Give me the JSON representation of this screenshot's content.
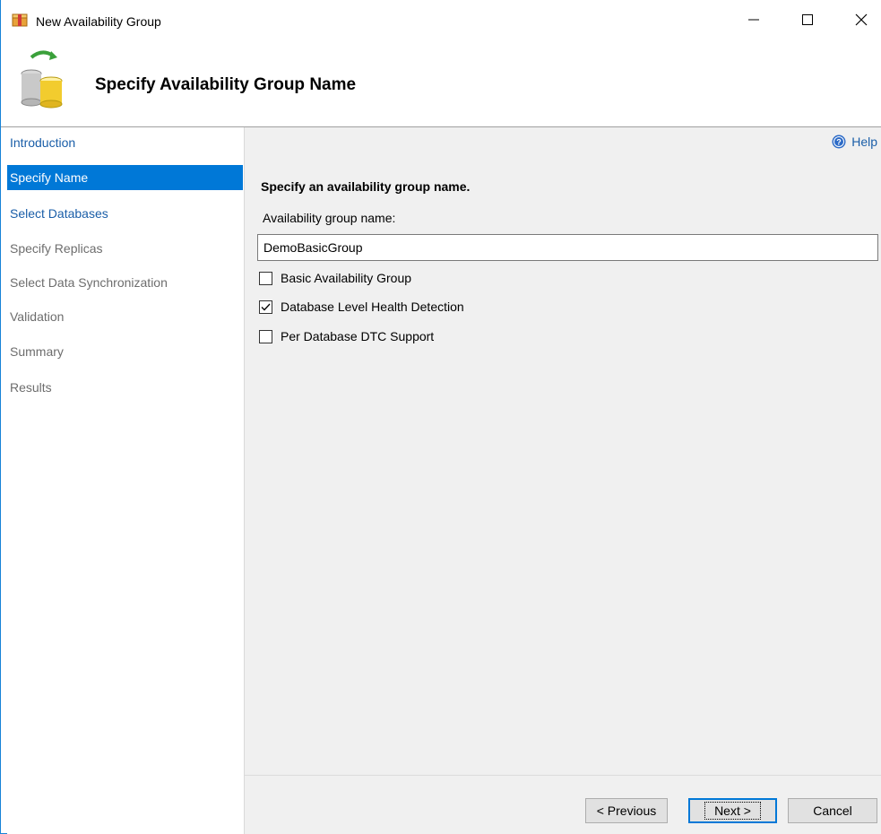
{
  "window": {
    "title": "New Availability Group",
    "minimize_glyph": "—",
    "maximize_glyph": "☐",
    "close_glyph": "✕"
  },
  "header": {
    "title": "Specify Availability Group Name",
    "icon": "database-sync-icon"
  },
  "nav": {
    "items": [
      {
        "label": "Introduction",
        "state": "link"
      },
      {
        "label": "Specify Name",
        "state": "active"
      },
      {
        "label": "Select Databases",
        "state": "link"
      },
      {
        "label": "Specify Replicas",
        "state": "disabled"
      },
      {
        "label": "Select Data Synchronization",
        "state": "disabled"
      },
      {
        "label": "Validation",
        "state": "disabled"
      },
      {
        "label": "Summary",
        "state": "disabled"
      },
      {
        "label": "Results",
        "state": "disabled"
      }
    ]
  },
  "content": {
    "help_label": "Help",
    "section_title": "Specify an availability group name.",
    "name_label": "Availability group name:",
    "name_value": "DemoBasicGroup",
    "checkboxes": [
      {
        "label": "Basic Availability Group",
        "checked": false
      },
      {
        "label": "Database Level Health Detection",
        "checked": true
      },
      {
        "label": "Per Database DTC Support",
        "checked": false
      }
    ]
  },
  "footer": {
    "previous_label": "< Previous",
    "next_label": "Next >",
    "cancel_label": "Cancel"
  },
  "colors": {
    "accent": "#0078d7",
    "link": "#1a5ea8",
    "disabled_text": "#6d6d6d",
    "panel_bg": "#f0f0f0"
  }
}
